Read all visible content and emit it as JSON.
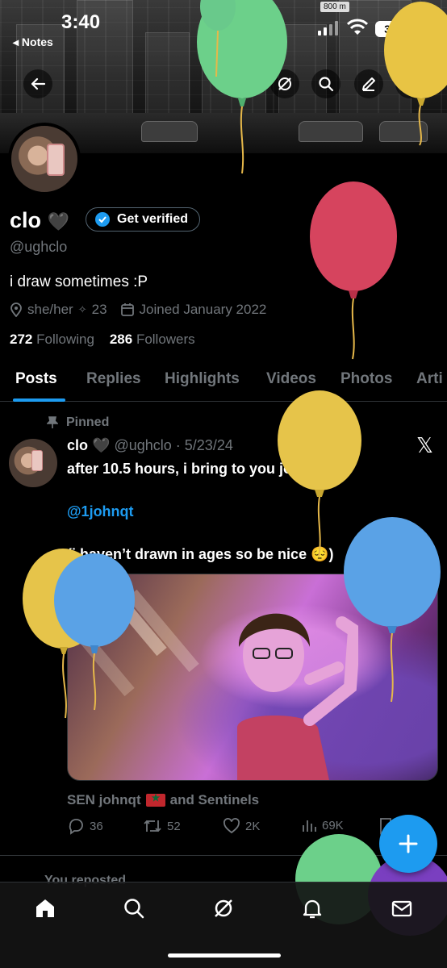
{
  "status_bar": {
    "time": "3:40",
    "back_app": "◂ Notes",
    "battery": "36"
  },
  "banner": {
    "road_sign": "800 m"
  },
  "profile": {
    "name": "clo",
    "name_emoji": "🖤",
    "verify_button": "Get verified",
    "handle": "@ughclo",
    "bio": "i draw sometimes :P",
    "pronouns": "she/her",
    "age_sep": "✧",
    "age": "23",
    "joined": "Joined January 2022",
    "following_count": "272",
    "following_label": "Following",
    "followers_count": "286",
    "followers_label": "Followers"
  },
  "tabs": [
    "Posts",
    "Replies",
    "Highlights",
    "Videos",
    "Photos",
    "Arti"
  ],
  "active_tab": "Posts",
  "pinned_post": {
    "pinned_label": "Pinned",
    "author": "clo",
    "author_emoji": "🖤",
    "handle_date": "@ughclo · 5/23/24",
    "line1": "after 10.5 hours, i bring to you johnqt",
    "mention": "@1johnqt",
    "line3": "(i haven’t drawn in ages so be nice 😔)",
    "caption_prefix": "SEN johnqt",
    "caption_suffix": "and Sentinels",
    "replies": "36",
    "reposts": "52",
    "likes": "2K",
    "views": "69K"
  },
  "next_post": {
    "reposted_label": "You reposted"
  },
  "colors": {
    "accent": "#1d9bf0",
    "muted": "#71767b",
    "background": "#000000",
    "border": "#2f3336"
  },
  "icons": [
    "back-arrow-icon",
    "grok-icon",
    "search-icon",
    "edit-icon",
    "share-icon",
    "location-icon",
    "calendar-icon",
    "pin-icon",
    "x-logo-icon",
    "reply-icon",
    "repost-icon",
    "like-icon",
    "views-icon",
    "bookmark-icon",
    "compose-plus-icon",
    "home-icon",
    "notifications-icon",
    "messages-icon"
  ]
}
